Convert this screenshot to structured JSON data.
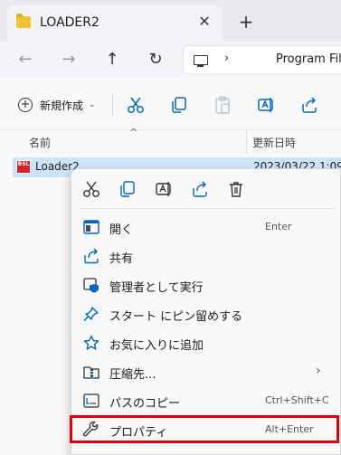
{
  "window": {
    "tab_title": "LOADER2",
    "close_glyph": "✕",
    "new_tab_glyph": "+"
  },
  "nav": {
    "back_glyph": "←",
    "forward_glyph": "→",
    "up_glyph": "↑",
    "refresh_glyph": "↻",
    "address_chevron": "›",
    "address_text": "Program Fil"
  },
  "toolbar": {
    "new_label": "新規作成",
    "new_chevron": "⌄",
    "new_plus": "+"
  },
  "columns": {
    "name": "名前",
    "sort_caret": "^",
    "date": "更新日時"
  },
  "file": {
    "icon_text": "BSL",
    "name": "Loader2",
    "date": "2023/03/22 1:09"
  },
  "context_menu": {
    "items": [
      {
        "label": "開く",
        "accel": "Enter",
        "icon": "open-icon"
      },
      {
        "label": "共有",
        "accel": "",
        "icon": "share-icon"
      },
      {
        "label": "管理者として実行",
        "accel": "",
        "icon": "shield-icon"
      },
      {
        "label": "スタート にピン留めする",
        "accel": "",
        "icon": "pin-icon"
      },
      {
        "label": "お気に入りに追加",
        "accel": "",
        "icon": "star-icon"
      },
      {
        "label": "圧縮先...",
        "accel": "",
        "icon": "zip-icon",
        "submenu_arrow": "›"
      },
      {
        "label": "パスのコピー",
        "accel": "Ctrl+Shift+C",
        "icon": "copy-path-icon"
      },
      {
        "label": "プロパティ",
        "accel": "Alt+Enter",
        "icon": "wrench-icon"
      }
    ]
  },
  "colors": {
    "accent": "#0067c0",
    "selection": "#cce4f7",
    "highlight_box": "#e0000e"
  }
}
